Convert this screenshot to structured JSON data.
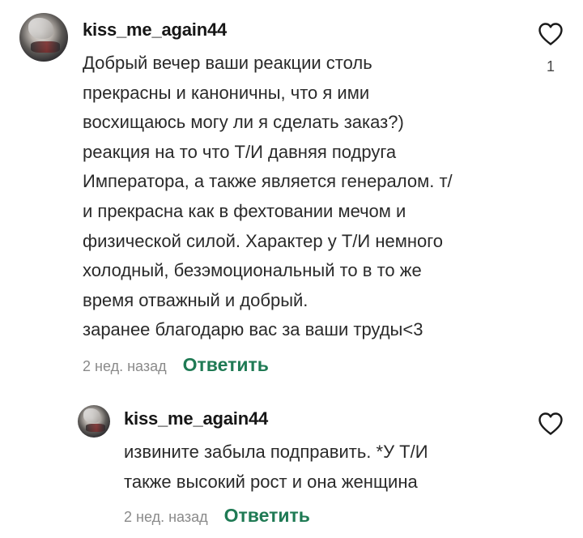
{
  "comment": {
    "username": "kiss_me_again44",
    "text_lines": [
      "Добрый вечер ваши реакции столь",
      "прекрасны и каноничны, что я ими",
      "восхищаюсь могу ли я сделать заказ?)",
      "реакция на то что Т/И давняя подруга",
      "Императора, а также является генералом. т/",
      "и прекрасна как в фехтовании мечом и",
      "физической силой. Характер у Т/И немного",
      "холодный, безэмоциональный то в то же",
      "время отважный и добрый.",
      "заранее благодарю вас за ваши труды<3"
    ],
    "timestamp": "2 нед. назад",
    "reply_label": "Ответить",
    "like_count": "1",
    "like_icon": "heart-outline-icon"
  },
  "reply": {
    "username": "kiss_me_again44",
    "text_lines": [
      "извините забыла подправить. *У Т/И",
      "также высокий рост и она женщина"
    ],
    "timestamp": "2 нед. назад",
    "reply_label": "Ответить",
    "like_icon": "heart-outline-icon"
  },
  "colors": {
    "reply_link": "#1f7a54",
    "timestamp": "#8a8a8a",
    "text": "#2a2a2a"
  }
}
